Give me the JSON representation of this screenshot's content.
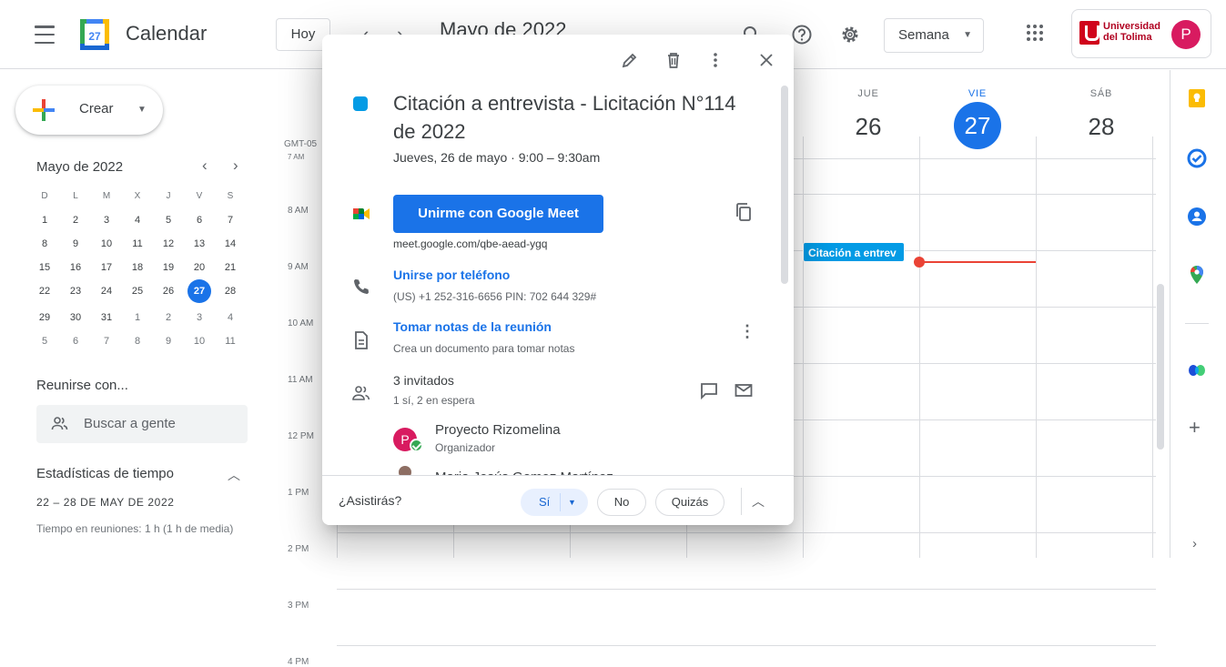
{
  "header": {
    "app_name": "Calendar",
    "logo_day": "27",
    "today_button": "Hoy",
    "prev_arrow": "‹",
    "next_arrow": "›",
    "month_title": "Mayo de 2022",
    "view_selector": "Semana",
    "org_name_line1": "Universidad",
    "org_name_line2": "del Tolima",
    "avatar_initial": "P",
    "icons": [
      "menu-icon",
      "search-icon",
      "help-icon",
      "settings-icon",
      "apps-icon"
    ]
  },
  "sidebar": {
    "create_label": "Crear",
    "mini_cal": {
      "title": "Mayo de 2022",
      "weekdays": [
        "D",
        "L",
        "M",
        "X",
        "J",
        "V",
        "S"
      ],
      "weeks": [
        [
          "1",
          "2",
          "3",
          "4",
          "5",
          "6",
          "7"
        ],
        [
          "8",
          "9",
          "10",
          "11",
          "12",
          "13",
          "14"
        ],
        [
          "15",
          "16",
          "17",
          "18",
          "19",
          "20",
          "21"
        ],
        [
          "22",
          "23",
          "24",
          "25",
          "26",
          "27",
          "28"
        ],
        [
          "29",
          "30",
          "31",
          "1",
          "2",
          "3",
          "4"
        ],
        [
          "5",
          "6",
          "7",
          "8",
          "9",
          "10",
          "11"
        ]
      ],
      "today": "27"
    },
    "meet_title": "Reunirse con...",
    "search_people": "Buscar a gente",
    "stats_title": "Estadísticas de tiempo",
    "stats_range": "22 – 28 DE MAY DE 2022",
    "stats_text": "Tiempo en reuniones: 1 h (1 h de media)"
  },
  "grid": {
    "timezone": "GMT-05",
    "hours": [
      "7 AM",
      "8 AM",
      "9 AM",
      "10 AM",
      "11 AM",
      "12 PM",
      "1 PM",
      "2 PM",
      "3 PM",
      "4 PM"
    ],
    "days": [
      {
        "dow": "JUE",
        "date": "26"
      },
      {
        "dow": "VIE",
        "date": "27",
        "today": true
      },
      {
        "dow": "SÁB",
        "date": "28"
      }
    ],
    "event_chip": "Citación a entrev"
  },
  "popover": {
    "title": "Citación a entrevista - Licitación N°114 de 2022",
    "date_time": "Jueves, 26 de mayo · 9:00 – 9:30am",
    "meet_button": "Unirme con Google Meet",
    "meet_url": "meet.google.com/qbe-aead-ygq",
    "phone_link": "Unirse por teléfono",
    "phone_detail": "(US) +1 252-316-6656 PIN: 702 644 329#",
    "notes_link": "Tomar notas de la reunión",
    "notes_detail": "Crea un documento para tomar notas",
    "guests_count": "3 invitados",
    "guests_status": "1 sí, 2 en espera",
    "guests": [
      {
        "initial": "P",
        "name": "Proyecto Rizomelina",
        "role": "Organizador"
      },
      {
        "name": "Maria Jesús Gomez Martínez"
      }
    ],
    "rsvp": {
      "question": "¿Asistirás?",
      "yes": "Sí",
      "no": "No",
      "maybe": "Quizás"
    },
    "event_color": "#039be5"
  },
  "colors": {
    "accent": "#1a73e8",
    "now_line": "#ea4335"
  }
}
